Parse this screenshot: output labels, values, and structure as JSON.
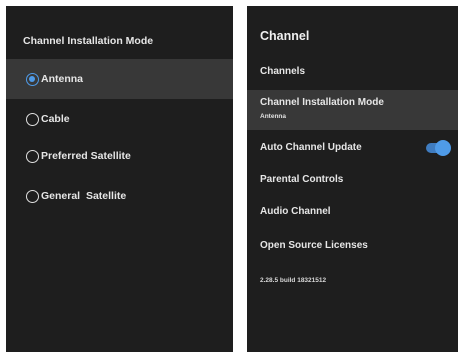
{
  "installation_mode_panel": {
    "title": "Channel Installation Mode",
    "options": [
      {
        "label": "Antenna",
        "selected": true
      },
      {
        "label": "Cable",
        "selected": false
      },
      {
        "label": "Preferred Satellite",
        "selected": false
      },
      {
        "label": "General  Satellite",
        "selected": false
      }
    ],
    "accent_color": "#4f9be8"
  },
  "channel_panel": {
    "title": "Channel",
    "items": [
      {
        "label": "Channels"
      },
      {
        "label": "Channel Installation Mode",
        "sublabel": "Antenna",
        "active": true
      },
      {
        "label": "Auto Channel Update",
        "toggle_on": true
      },
      {
        "label": "Parental Controls"
      },
      {
        "label": "Audio Channel"
      },
      {
        "label": "Open Source Licenses"
      }
    ],
    "version": "2.28.5 build 18321512"
  },
  "colors": {
    "panel_background": "#1e1e1e",
    "highlight_background": "#383838",
    "text": "#e6e6e6",
    "accent": "#4f9be8"
  }
}
